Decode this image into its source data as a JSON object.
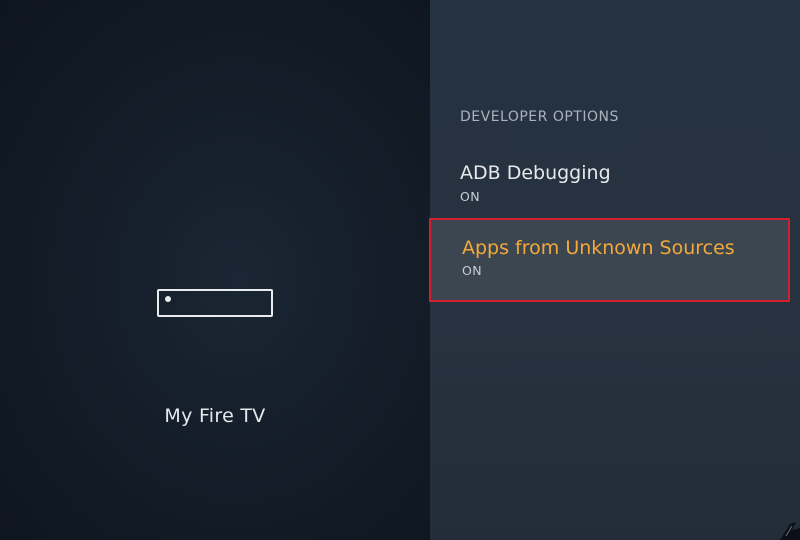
{
  "left_pane": {
    "device_icon": "fire-tv-stick-icon",
    "device_name": "My Fire TV"
  },
  "developer_options": {
    "header": "DEVELOPER OPTIONS",
    "items": [
      {
        "label": "ADB Debugging",
        "status": "ON",
        "selected": false
      },
      {
        "label": "Apps from Unknown Sources",
        "status": "ON",
        "selected": true
      }
    ]
  },
  "colors": {
    "focus_text": "#f4a93a",
    "focus_border": "#d3202f",
    "focus_background": "#3c4651",
    "left_background": "#141d29",
    "right_background": "#26323f"
  }
}
